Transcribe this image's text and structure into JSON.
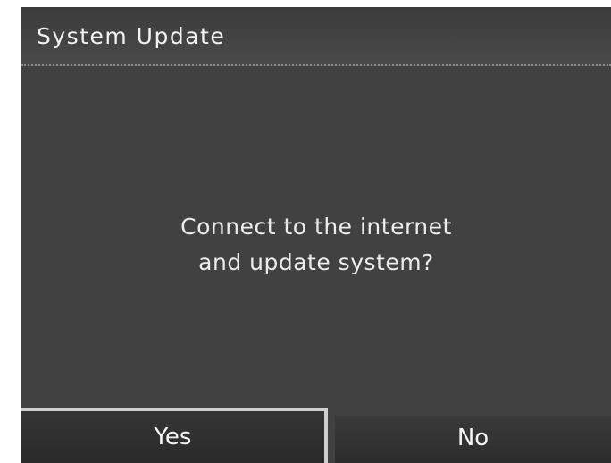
{
  "dialog": {
    "title": "System Update",
    "message_lines": [
      "Connect to the internet",
      "and update system?"
    ],
    "buttons": {
      "yes_label": "Yes",
      "no_label": "No",
      "selected": "Yes"
    }
  },
  "colors": {
    "background": "#414141",
    "text": "#f2f2f2",
    "selection_border": "#cfcfcf"
  }
}
